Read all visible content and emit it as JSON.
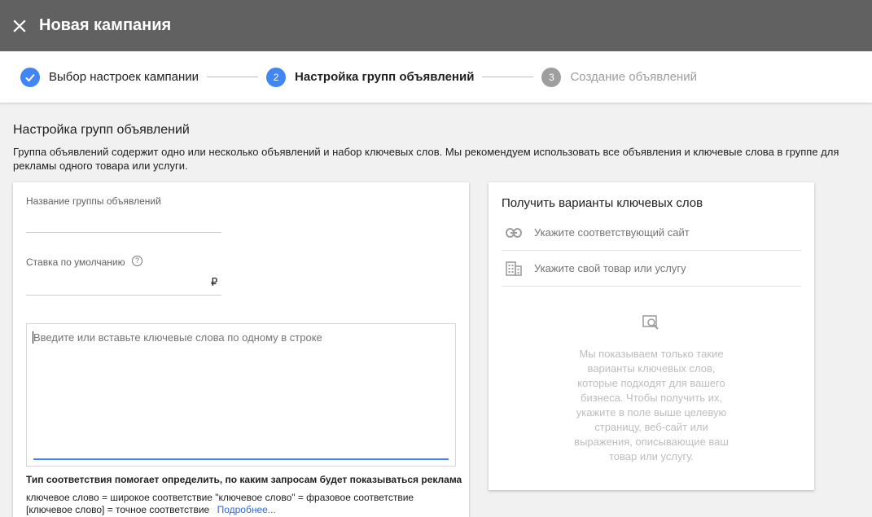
{
  "header": {
    "close_icon": "close-icon",
    "title": "Новая кампания"
  },
  "stepper": {
    "steps": [
      {
        "label": "Выбор настроек кампании",
        "state": "done",
        "marker": ""
      },
      {
        "label": "Настройка групп объявлений",
        "state": "active",
        "marker": "2"
      },
      {
        "label": "Создание объявлений",
        "state": "pending",
        "marker": "3"
      }
    ]
  },
  "section": {
    "title": "Настройка групп объявлений",
    "description": "Группа объявлений содержит одно или несколько объявлений и набор ключевых слов. Мы рекомендуем использовать все объявления и ключевые слова в группе для рекламы одного товара или услуги."
  },
  "adgroup_form": {
    "name_label": "Название группы объявлений",
    "name_value": "",
    "bid_label": "Ставка по умолчанию",
    "bid_help": "?",
    "bid_value": "",
    "currency": "₽",
    "keywords_placeholder": "Введите или вставьте ключевые слова по одному в строке",
    "match_type_title": "Тип соответствия помогает определить, по каким запросам будет показываться реклама",
    "match_line1": "ключевое слово = широкое соответствие   \"ключевое слово\" = фразовое соответствие",
    "match_line2": "[ключевое слово] = точное соответствие",
    "more_link": "Подробнее..."
  },
  "keyword_ideas": {
    "title": "Получить варианты ключевых слов",
    "site_placeholder": "Укажите соответствующий сайт",
    "site_icon": "link-icon",
    "product_placeholder": "Укажите свой товар или услугу",
    "product_icon": "building-icon",
    "empty_icon": "search-box-icon",
    "empty_text": "Мы показываем только такие варианты ключевых слов, которые подходят для вашего бизнеса. Чтобы получить их, укажите в поле выше целевую страницу, веб-сайт или выражения, описывающие ваш товар или услугу."
  },
  "colors": {
    "header_bg": "#616161",
    "accent": "#4285f4",
    "link": "#3367d6"
  }
}
